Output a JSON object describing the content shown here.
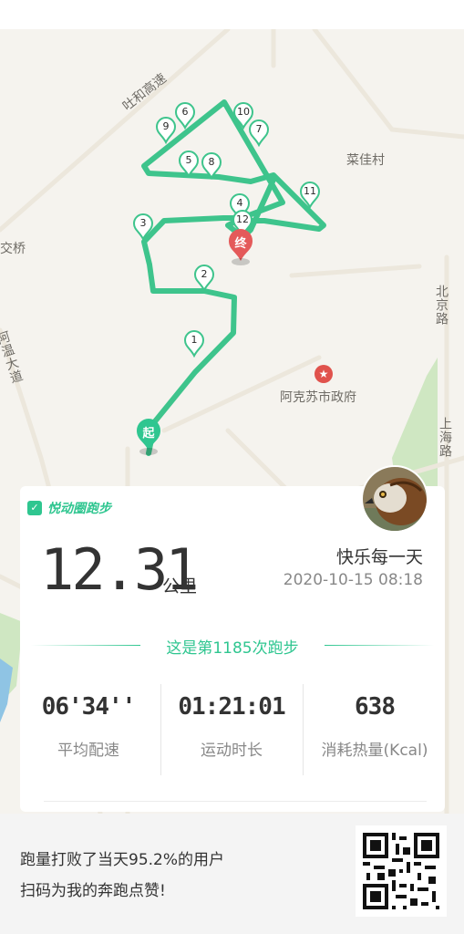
{
  "map": {
    "labels": {
      "turpan_expressway": "吐和高速",
      "caijia_village": "菜佳村",
      "jiaoqiao": "交桥",
      "awen_avenue": "阿温大道",
      "beijing_road": "北京路",
      "shanghai_road": "上海路",
      "government": "阿克苏市政府"
    },
    "markers": {
      "km1": "1",
      "km2": "2",
      "km3": "3",
      "km4": "4",
      "km5": "5",
      "km6": "6",
      "km7": "7",
      "km8": "8",
      "km9": "9",
      "km10": "10",
      "km11": "11",
      "km12": "12",
      "start": "起",
      "end": "终"
    },
    "route_color": "#3ec48c"
  },
  "card": {
    "brand": "悦动圈跑步",
    "distance": "12.31",
    "distance_unit": "公里",
    "username": "快乐每一天",
    "datetime": "2020-10-15 08:18",
    "run_count": "这是第1185次跑步",
    "stats": [
      {
        "value": "06'34''",
        "label": "平均配速"
      },
      {
        "value": "01:21:01",
        "label": "运动时长"
      },
      {
        "value": "638",
        "label": "消耗热量(Kcal)"
      }
    ]
  },
  "footer": {
    "line1": "跑量打败了当天95.2%的用户",
    "line2": "扫码为我的奔跑点赞!"
  },
  "colors": {
    "accent": "#2fc690",
    "end_marker": "#e45a5a"
  }
}
